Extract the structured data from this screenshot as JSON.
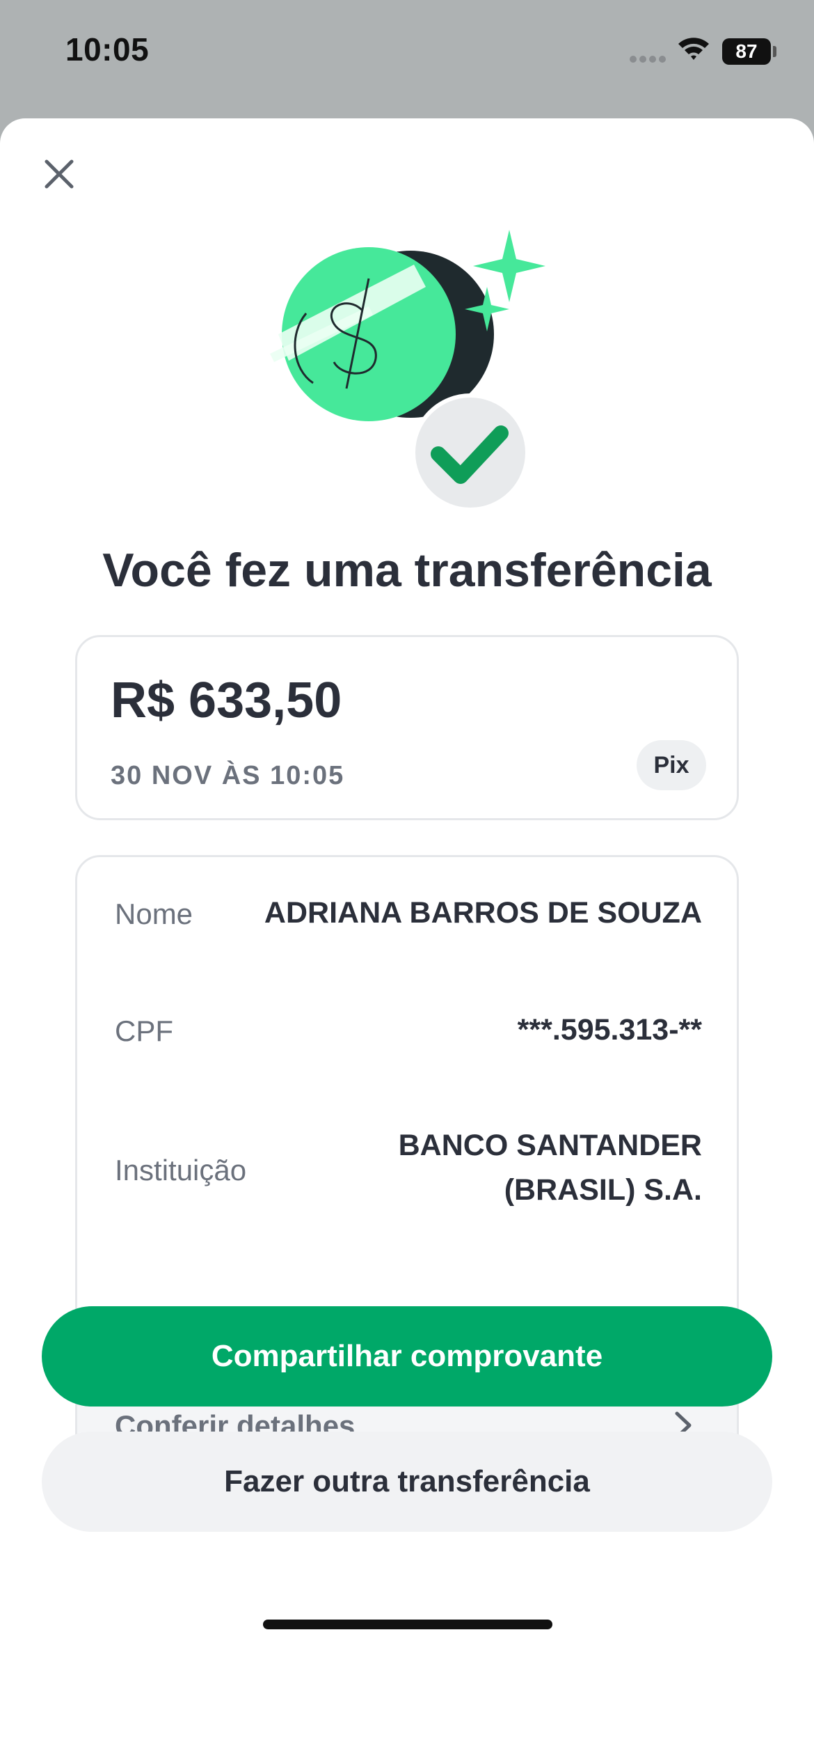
{
  "status_bar": {
    "time": "10:05",
    "battery": "87"
  },
  "header": {
    "close_icon": "close-icon"
  },
  "hero": {
    "icon": "money-success-illustration",
    "colors": {
      "green": "#46e89a",
      "dark": "#1f2a2e",
      "check": "#0f9d58"
    }
  },
  "title": "Você fez uma transferência",
  "amount_card": {
    "amount": "R$ 633,50",
    "date": "30 NOV ÀS 10:05",
    "method": "Pix"
  },
  "details": {
    "rows": [
      {
        "label": "Nome",
        "value": "ADRIANA BARROS DE SOUZA"
      },
      {
        "label": "CPF",
        "value": "***.595.313-**"
      },
      {
        "label": "Instituição",
        "value_line1": "BANCO SANTANDER",
        "value_line2": "(BRASIL) S.A."
      }
    ],
    "footer_label": "Conferir detalhes",
    "footer_icon": "chevron-right-icon"
  },
  "actions": {
    "primary_label": "Compartilhar comprovante",
    "secondary_label": "Fazer outra transferência"
  },
  "colors": {
    "accent": "#00a868",
    "text": "#2b2f3a",
    "muted": "#6b717c"
  }
}
